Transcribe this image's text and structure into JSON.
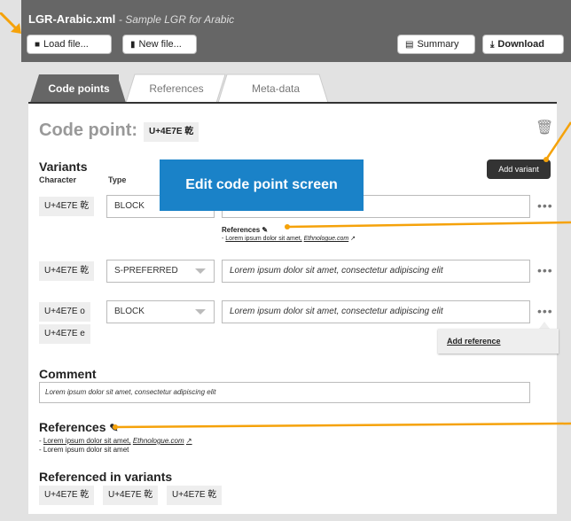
{
  "header": {
    "filename": "LGR-Arabic.xml",
    "subtitle": "- Sample LGR for Arabic",
    "load_label": "Load file...",
    "new_label": "New file...",
    "summary_label": "Summary",
    "download_label": "Download",
    "load_icon": "folder-icon",
    "new_icon": "document-icon",
    "summary_icon": "clipboard-icon",
    "download_icon": "download-icon"
  },
  "tabs": [
    {
      "label": "Code points",
      "active": true
    },
    {
      "label": "References",
      "active": false
    },
    {
      "label": "Meta-data",
      "active": false
    }
  ],
  "codepoint": {
    "label": "Code point:",
    "value": "U+4E7E 乾"
  },
  "variants": {
    "title": "Variants",
    "col_character": "Character",
    "col_type": "Type",
    "add_label": "Add variant",
    "rows": [
      {
        "char": "U+4E7E 乾",
        "type": "BLOCK",
        "comment": ""
      },
      {
        "char": "U+4E7E 乾",
        "type": "S-PREFERRED",
        "comment": "Lorem ipsum dolor sit amet, consectetur adipiscing elit"
      },
      {
        "char": "U+4E7E ο",
        "char2": "U+4E7E e",
        "type": "BLOCK",
        "comment": "Lorem ipsum dolor sit amet, consectetur adipiscing elit"
      }
    ],
    "row_refs_label": "References",
    "row_refs_link": "Lorem ipsum dolor sit amet,",
    "row_refs_source": "Ethnologue.com",
    "add_reference_label": "Add reference",
    "more_label": "•••"
  },
  "callout": "Edit code point screen",
  "comment": {
    "title": "Comment",
    "text": "Lorem ipsum dolor sit amet, consectetur adipiscing elit"
  },
  "references": {
    "title": "References",
    "line1_link": "Lorem ipsum dolor sit amet,",
    "line1_source": "Ethnologue.com",
    "line2": "Lorem ipsum dolor sit amet"
  },
  "referenced": {
    "title": "Referenced in variants",
    "items": [
      "U+4E7E 乾",
      "U+4E7E 乾",
      "U+4E7E 乾"
    ]
  },
  "colors": {
    "accent": "#f5a20a",
    "callout": "#1a82c8",
    "header": "#666666"
  }
}
